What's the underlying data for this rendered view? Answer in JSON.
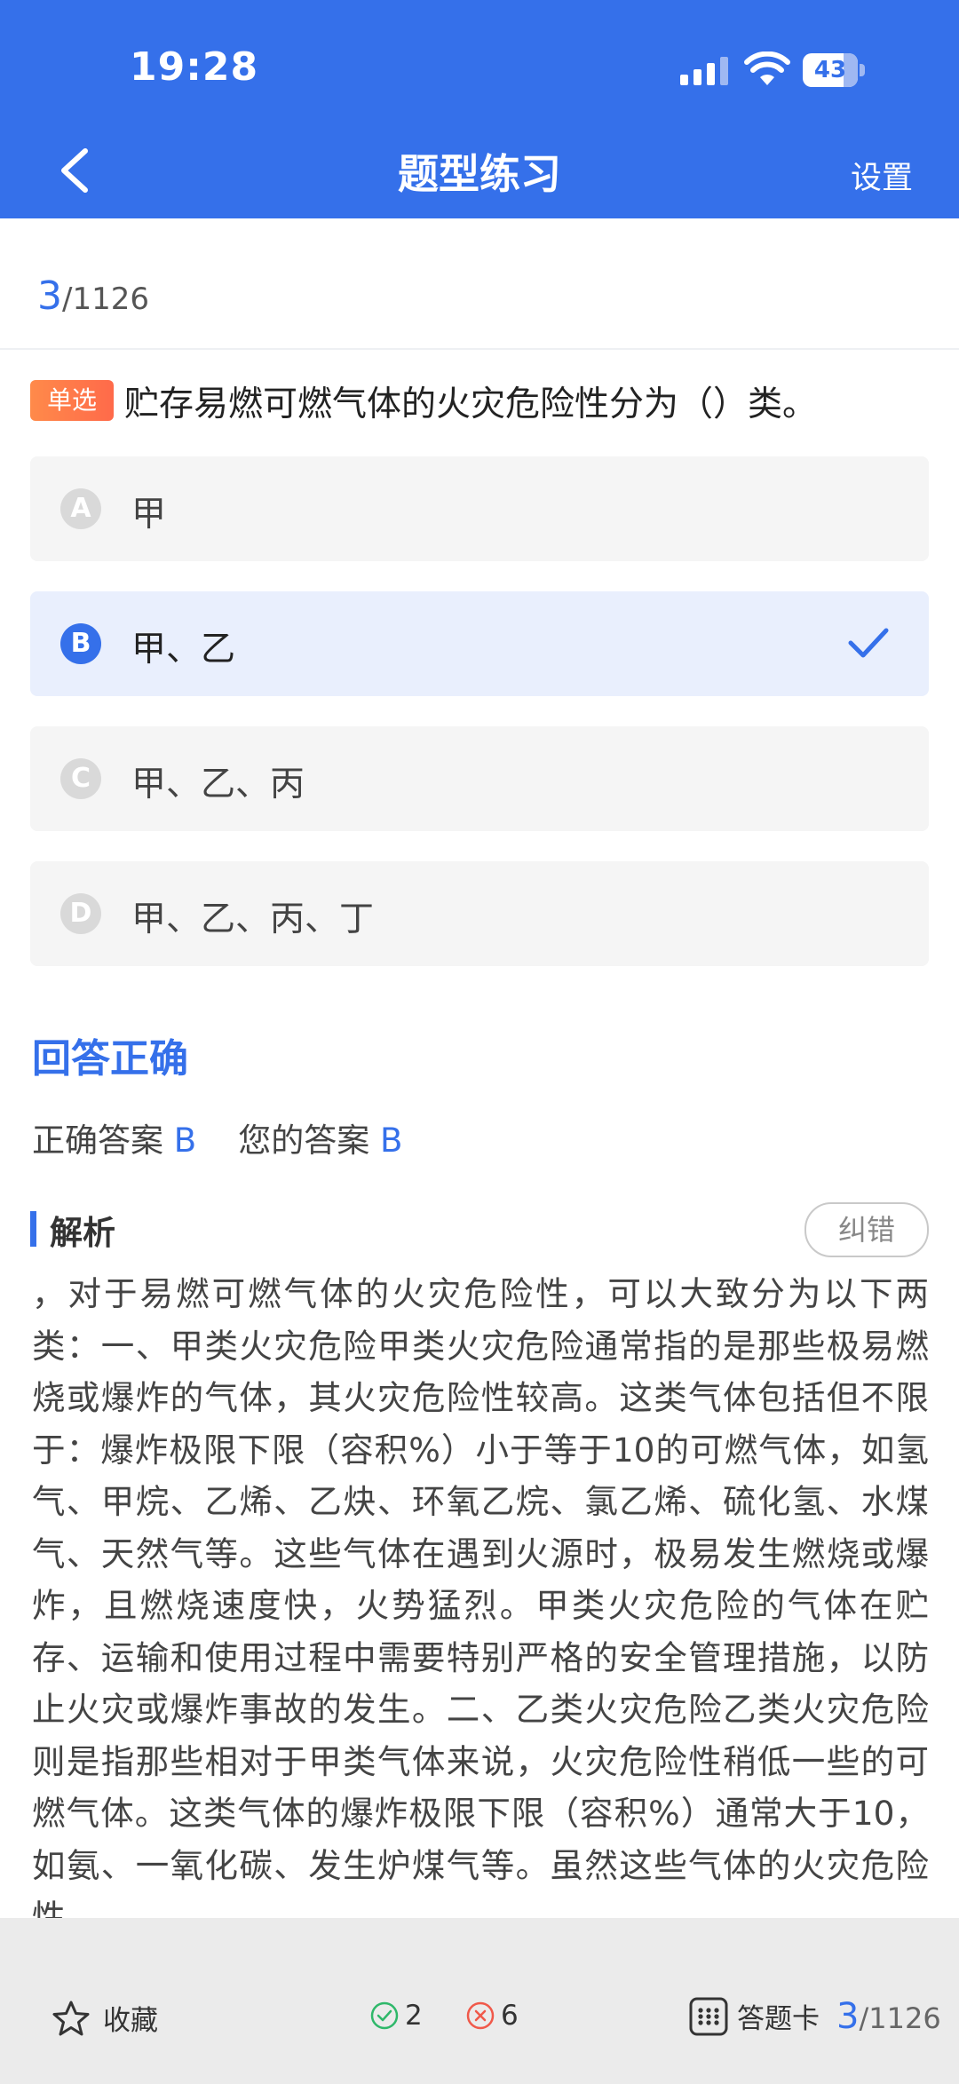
{
  "status": {
    "time": "19:28",
    "battery": "43"
  },
  "header": {
    "title": "题型练习",
    "settings_label": "设置"
  },
  "progress": {
    "current": "3",
    "total": "/1126"
  },
  "question": {
    "type_badge": "单选",
    "text": "贮存易燃可燃气体的火灾危险性分为（）类。",
    "options": [
      {
        "letter": "A",
        "text": "甲",
        "selected": false
      },
      {
        "letter": "B",
        "text": "甲、乙",
        "selected": true
      },
      {
        "letter": "C",
        "text": "甲、乙、丙",
        "selected": false
      },
      {
        "letter": "D",
        "text": "甲、乙、丙、丁",
        "selected": false
      }
    ]
  },
  "result": {
    "title": "回答正确",
    "correct_label": "正确答案",
    "correct_value": "B",
    "yours_label": "您的答案",
    "yours_value": "B"
  },
  "analysis": {
    "label": "解析",
    "report_label": "纠错",
    "text": "，对于易燃可燃气体的火灾危险性，可以大致分为以下两类：一、甲类火灾危险甲类火灾危险通常指的是那些极易燃烧或爆炸的气体，其火灾危险性较高。这类气体包括但不限于：爆炸极限下限（容积%）小于等于10的可燃气体，如氢气、甲烷、乙烯、乙炔、环氧乙烷、氯乙烯、硫化氢、水煤气、天然气等。这些气体在遇到火源时，极易发生燃烧或爆炸，且燃烧速度快，火势猛烈。甲类火灾危险的气体在贮存、运输和使用过程中需要特别严格的安全管理措施，以防止火灾或爆炸事故的发生。二、乙类火灾危险乙类火灾危险则是指那些相对于甲类气体来说，火灾危险性稍低一些的可燃气体。这类气体的爆炸极限下限（容积%）通常大于10，如氨、一氧化碳、发生炉煤气等。虽然这些气体的火灾危险性"
  },
  "bottom": {
    "favorite_label": "收藏",
    "right_count": "2",
    "wrong_count": "6",
    "card_label": "答题卡",
    "current": "3",
    "total": "/1126"
  },
  "colors": {
    "primary": "#3570ea",
    "badge": "#ff7a4a",
    "right": "#2fb86a",
    "wrong": "#f0594a"
  }
}
